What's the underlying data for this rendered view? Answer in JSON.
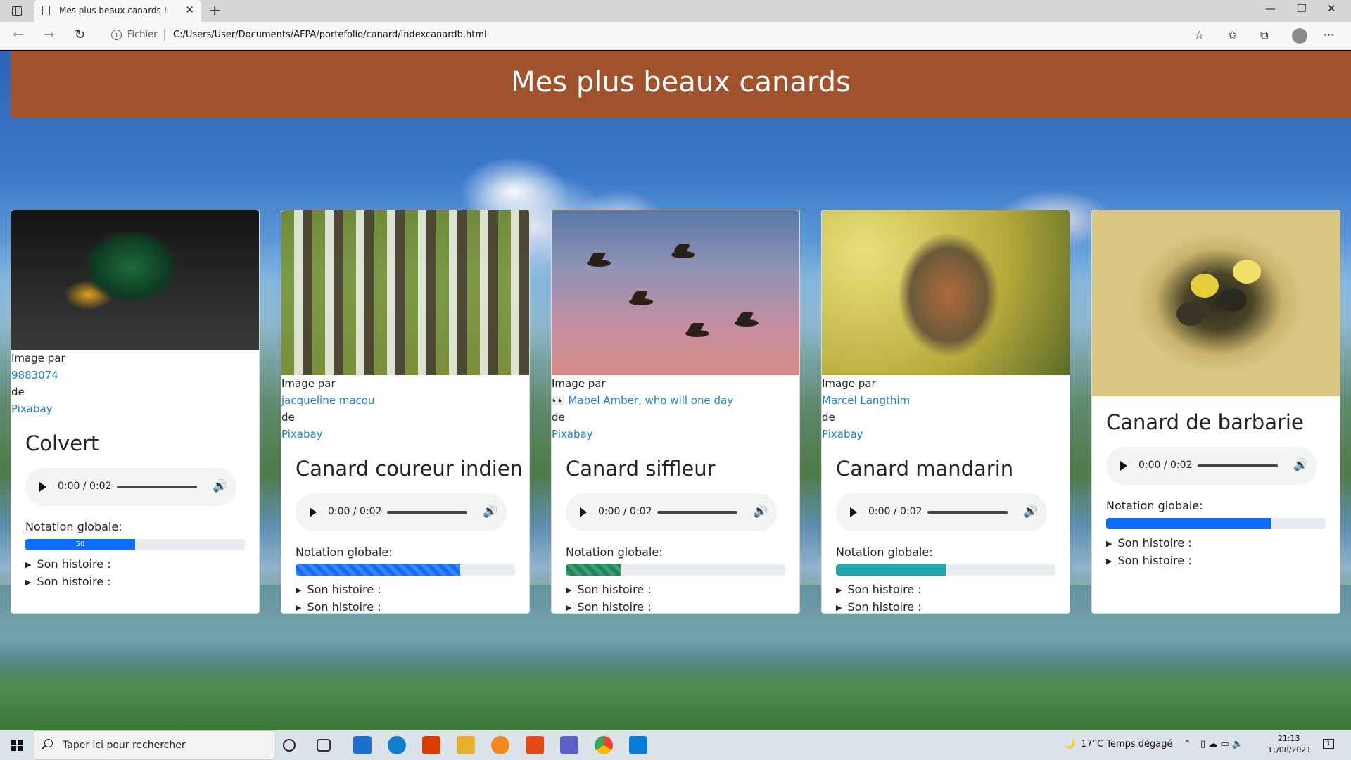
{
  "browser": {
    "tab_title": "Mes plus beaux canards !",
    "new_tab": "+",
    "address_prefix": "Fichier",
    "address_url": "C:/Users/User/Documents/AFPA/portefolio/canard/indexcanardb.html",
    "info_glyph": "i",
    "back_glyph": "←",
    "forward_glyph": "→",
    "reload_glyph": "↻",
    "tab_close": "✕",
    "minimize": "—",
    "restore": "❐",
    "close": "✕",
    "favorite_glyph": "☆",
    "favorites_glyph": "✩",
    "collections_glyph": "⧉",
    "more_glyph": "···"
  },
  "page": {
    "title": "Mes plus beaux canards",
    "image_label": "Image par",
    "de_label": "de",
    "rating_label": "Notation globale:",
    "story_label": "Son histoire :",
    "audio_time": "0:00 / 0:02"
  },
  "cards": [
    {
      "name": "Colvert",
      "author": "9883074",
      "source": "Pixabay",
      "rating_percent": 50,
      "rating_text": "50",
      "bar_color": "#0d6efd",
      "striped": false,
      "image": "mallard duck close-up"
    },
    {
      "name": "Canard coureur indien",
      "author": "jacqueline macou",
      "source": "Pixabay",
      "rating_percent": 75,
      "rating_text": "",
      "bar_color": "#0d6efd",
      "striped": true,
      "image": "flock of indian runner ducks"
    },
    {
      "name": "Canard siffleur",
      "author": "Mabel Amber, who will one day",
      "author_prefix_icon": "eyes-emoji",
      "source": "Pixabay",
      "rating_percent": 25,
      "rating_text": "",
      "bar_color": "#198754",
      "striped": true,
      "image": "ducks flying at sunset"
    },
    {
      "name": "Canard mandarin",
      "author": "Marcel Langthim",
      "source": "Pixabay",
      "rating_percent": 50,
      "rating_text": "",
      "bar_color": "#20a8b0",
      "striped": false,
      "image": "mandarin duck"
    },
    {
      "name": "Canard de barbarie",
      "author": "",
      "source": "",
      "rating_percent": 75,
      "rating_text": "",
      "bar_color": "#0d6efd",
      "striped": false,
      "image": "ducklings in nest"
    }
  ],
  "taskbar": {
    "search_placeholder": "Taper ici pour rechercher",
    "weather": "17°C  Temps dégagé",
    "time": "21:13",
    "date": "31/08/2021",
    "notification_count": "1"
  }
}
